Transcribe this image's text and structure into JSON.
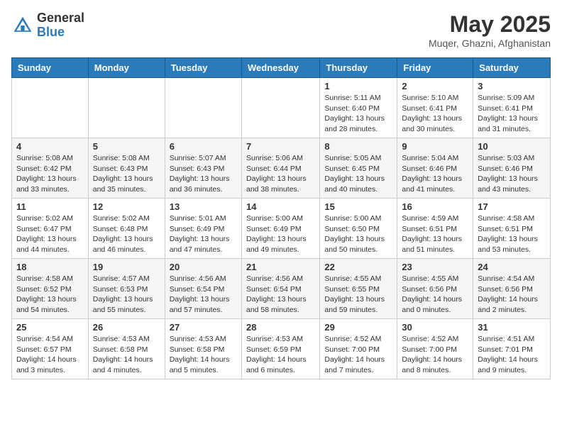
{
  "header": {
    "logo_general": "General",
    "logo_blue": "Blue",
    "month_title": "May 2025",
    "location": "Muqer, Ghazni, Afghanistan"
  },
  "calendar": {
    "days_of_week": [
      "Sunday",
      "Monday",
      "Tuesday",
      "Wednesday",
      "Thursday",
      "Friday",
      "Saturday"
    ],
    "weeks": [
      [
        {
          "day": "",
          "info": ""
        },
        {
          "day": "",
          "info": ""
        },
        {
          "day": "",
          "info": ""
        },
        {
          "day": "",
          "info": ""
        },
        {
          "day": "1",
          "info": "Sunrise: 5:11 AM\nSunset: 6:40 PM\nDaylight: 13 hours\nand 28 minutes."
        },
        {
          "day": "2",
          "info": "Sunrise: 5:10 AM\nSunset: 6:41 PM\nDaylight: 13 hours\nand 30 minutes."
        },
        {
          "day": "3",
          "info": "Sunrise: 5:09 AM\nSunset: 6:41 PM\nDaylight: 13 hours\nand 31 minutes."
        }
      ],
      [
        {
          "day": "4",
          "info": "Sunrise: 5:08 AM\nSunset: 6:42 PM\nDaylight: 13 hours\nand 33 minutes."
        },
        {
          "day": "5",
          "info": "Sunrise: 5:08 AM\nSunset: 6:43 PM\nDaylight: 13 hours\nand 35 minutes."
        },
        {
          "day": "6",
          "info": "Sunrise: 5:07 AM\nSunset: 6:43 PM\nDaylight: 13 hours\nand 36 minutes."
        },
        {
          "day": "7",
          "info": "Sunrise: 5:06 AM\nSunset: 6:44 PM\nDaylight: 13 hours\nand 38 minutes."
        },
        {
          "day": "8",
          "info": "Sunrise: 5:05 AM\nSunset: 6:45 PM\nDaylight: 13 hours\nand 40 minutes."
        },
        {
          "day": "9",
          "info": "Sunrise: 5:04 AM\nSunset: 6:46 PM\nDaylight: 13 hours\nand 41 minutes."
        },
        {
          "day": "10",
          "info": "Sunrise: 5:03 AM\nSunset: 6:46 PM\nDaylight: 13 hours\nand 43 minutes."
        }
      ],
      [
        {
          "day": "11",
          "info": "Sunrise: 5:02 AM\nSunset: 6:47 PM\nDaylight: 13 hours\nand 44 minutes."
        },
        {
          "day": "12",
          "info": "Sunrise: 5:02 AM\nSunset: 6:48 PM\nDaylight: 13 hours\nand 46 minutes."
        },
        {
          "day": "13",
          "info": "Sunrise: 5:01 AM\nSunset: 6:49 PM\nDaylight: 13 hours\nand 47 minutes."
        },
        {
          "day": "14",
          "info": "Sunrise: 5:00 AM\nSunset: 6:49 PM\nDaylight: 13 hours\nand 49 minutes."
        },
        {
          "day": "15",
          "info": "Sunrise: 5:00 AM\nSunset: 6:50 PM\nDaylight: 13 hours\nand 50 minutes."
        },
        {
          "day": "16",
          "info": "Sunrise: 4:59 AM\nSunset: 6:51 PM\nDaylight: 13 hours\nand 51 minutes."
        },
        {
          "day": "17",
          "info": "Sunrise: 4:58 AM\nSunset: 6:51 PM\nDaylight: 13 hours\nand 53 minutes."
        }
      ],
      [
        {
          "day": "18",
          "info": "Sunrise: 4:58 AM\nSunset: 6:52 PM\nDaylight: 13 hours\nand 54 minutes."
        },
        {
          "day": "19",
          "info": "Sunrise: 4:57 AM\nSunset: 6:53 PM\nDaylight: 13 hours\nand 55 minutes."
        },
        {
          "day": "20",
          "info": "Sunrise: 4:56 AM\nSunset: 6:54 PM\nDaylight: 13 hours\nand 57 minutes."
        },
        {
          "day": "21",
          "info": "Sunrise: 4:56 AM\nSunset: 6:54 PM\nDaylight: 13 hours\nand 58 minutes."
        },
        {
          "day": "22",
          "info": "Sunrise: 4:55 AM\nSunset: 6:55 PM\nDaylight: 13 hours\nand 59 minutes."
        },
        {
          "day": "23",
          "info": "Sunrise: 4:55 AM\nSunset: 6:56 PM\nDaylight: 14 hours\nand 0 minutes."
        },
        {
          "day": "24",
          "info": "Sunrise: 4:54 AM\nSunset: 6:56 PM\nDaylight: 14 hours\nand 2 minutes."
        }
      ],
      [
        {
          "day": "25",
          "info": "Sunrise: 4:54 AM\nSunset: 6:57 PM\nDaylight: 14 hours\nand 3 minutes."
        },
        {
          "day": "26",
          "info": "Sunrise: 4:53 AM\nSunset: 6:58 PM\nDaylight: 14 hours\nand 4 minutes."
        },
        {
          "day": "27",
          "info": "Sunrise: 4:53 AM\nSunset: 6:58 PM\nDaylight: 14 hours\nand 5 minutes."
        },
        {
          "day": "28",
          "info": "Sunrise: 4:53 AM\nSunset: 6:59 PM\nDaylight: 14 hours\nand 6 minutes."
        },
        {
          "day": "29",
          "info": "Sunrise: 4:52 AM\nSunset: 7:00 PM\nDaylight: 14 hours\nand 7 minutes."
        },
        {
          "day": "30",
          "info": "Sunrise: 4:52 AM\nSunset: 7:00 PM\nDaylight: 14 hours\nand 8 minutes."
        },
        {
          "day": "31",
          "info": "Sunrise: 4:51 AM\nSunset: 7:01 PM\nDaylight: 14 hours\nand 9 minutes."
        }
      ]
    ]
  }
}
